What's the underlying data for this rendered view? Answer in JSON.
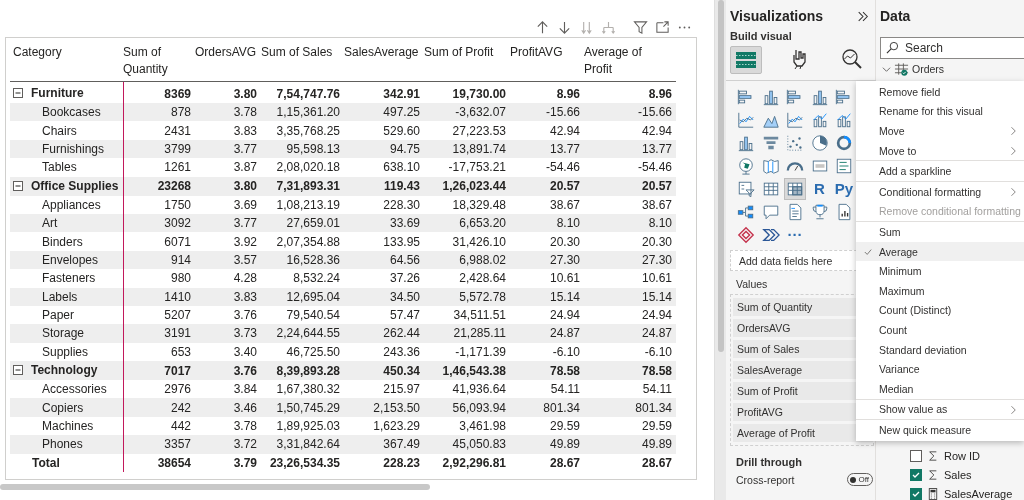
{
  "table": {
    "columns": [
      "Category",
      "Sum of Quantity",
      "OrdersAVG",
      "Sum of Sales",
      "SalesAverage",
      "Sum of Profit",
      "ProfitAVG",
      "Average of Profit"
    ],
    "groups": [
      {
        "name": "Furniture",
        "expanded": true,
        "values": [
          "8369",
          "3.80",
          "7,54,747.76",
          "342.91",
          "19,730.00",
          "8.96",
          "8.96"
        ],
        "children": [
          {
            "name": "Bookcases",
            "values": [
              "878",
              "3.78",
              "1,15,361.20",
              "497.25",
              "-3,632.07",
              "-15.66",
              "-15.66"
            ]
          },
          {
            "name": "Chairs",
            "values": [
              "2431",
              "3.83",
              "3,35,768.25",
              "529.60",
              "27,223.53",
              "42.94",
              "42.94"
            ]
          },
          {
            "name": "Furnishings",
            "values": [
              "3799",
              "3.77",
              "95,598.13",
              "94.75",
              "13,891.74",
              "13.77",
              "13.77"
            ]
          },
          {
            "name": "Tables",
            "values": [
              "1261",
              "3.87",
              "2,08,020.18",
              "638.10",
              "-17,753.21",
              "-54.46",
              "-54.46"
            ]
          }
        ]
      },
      {
        "name": "Office Supplies",
        "expanded": true,
        "values": [
          "23268",
          "3.80",
          "7,31,893.31",
          "119.43",
          "1,26,023.44",
          "20.57",
          "20.57"
        ],
        "children": [
          {
            "name": "Appliances",
            "values": [
              "1750",
              "3.69",
              "1,08,213.19",
              "228.30",
              "18,329.48",
              "38.67",
              "38.67"
            ]
          },
          {
            "name": "Art",
            "values": [
              "3092",
              "3.77",
              "27,659.01",
              "33.69",
              "6,653.20",
              "8.10",
              "8.10"
            ]
          },
          {
            "name": "Binders",
            "values": [
              "6071",
              "3.92",
              "2,07,354.88",
              "133.95",
              "31,426.10",
              "20.30",
              "20.30"
            ]
          },
          {
            "name": "Envelopes",
            "values": [
              "914",
              "3.57",
              "16,528.36",
              "64.56",
              "6,988.02",
              "27.30",
              "27.30"
            ]
          },
          {
            "name": "Fasteners",
            "values": [
              "980",
              "4.28",
              "8,532.24",
              "37.26",
              "2,428.64",
              "10.61",
              "10.61"
            ]
          },
          {
            "name": "Labels",
            "values": [
              "1410",
              "3.83",
              "12,695.04",
              "34.50",
              "5,572.78",
              "15.14",
              "15.14"
            ]
          },
          {
            "name": "Paper",
            "values": [
              "5207",
              "3.76",
              "79,540.54",
              "57.47",
              "34,511.51",
              "24.94",
              "24.94"
            ]
          },
          {
            "name": "Storage",
            "values": [
              "3191",
              "3.73",
              "2,24,644.55",
              "262.44",
              "21,285.11",
              "24.87",
              "24.87"
            ]
          },
          {
            "name": "Supplies",
            "values": [
              "653",
              "3.40",
              "46,725.50",
              "243.36",
              "-1,171.39",
              "-6.10",
              "-6.10"
            ]
          }
        ]
      },
      {
        "name": "Technology",
        "expanded": true,
        "values": [
          "7017",
          "3.76",
          "8,39,893.28",
          "450.34",
          "1,46,543.38",
          "78.58",
          "78.58"
        ],
        "children": [
          {
            "name": "Accessories",
            "values": [
              "2976",
              "3.84",
              "1,67,380.32",
              "215.97",
              "41,936.64",
              "54.11",
              "54.11"
            ]
          },
          {
            "name": "Copiers",
            "values": [
              "242",
              "3.46",
              "1,50,745.29",
              "2,153.50",
              "56,093.94",
              "801.34",
              "801.34"
            ]
          },
          {
            "name": "Machines",
            "values": [
              "442",
              "3.78",
              "1,89,925.03",
              "1,623.29",
              "3,461.98",
              "29.59",
              "29.59"
            ]
          },
          {
            "name": "Phones",
            "values": [
              "3357",
              "3.72",
              "3,31,842.64",
              "367.49",
              "45,050.83",
              "49.89",
              "49.89"
            ]
          }
        ]
      }
    ],
    "total": {
      "label": "Total",
      "values": [
        "38654",
        "3.79",
        "23,26,534.35",
        "228.23",
        "2,92,296.81",
        "28.67",
        "28.67"
      ]
    }
  },
  "visualizations_pane": {
    "title": "Visualizations",
    "subtitle": "Build visual",
    "build_tabs": [
      {
        "kind": "build",
        "selected": true
      },
      {
        "kind": "format",
        "selected": false
      },
      {
        "kind": "analytics",
        "selected": false
      }
    ],
    "visual_types": [
      {
        "kind": "bar",
        "selected": false
      },
      {
        "kind": "column",
        "selected": false
      },
      {
        "kind": "bar",
        "selected": false
      },
      {
        "kind": "column",
        "selected": false
      },
      {
        "kind": "bar",
        "selected": false
      },
      {
        "kind": "line",
        "selected": false
      },
      {
        "kind": "area",
        "selected": false
      },
      {
        "kind": "line",
        "selected": false
      },
      {
        "kind": "combo",
        "selected": false
      },
      {
        "kind": "combo",
        "selected": false
      },
      {
        "kind": "column",
        "selected": false
      },
      {
        "kind": "funnel",
        "selected": false
      },
      {
        "kind": "scatter",
        "selected": false
      },
      {
        "kind": "pie",
        "selected": false
      },
      {
        "kind": "donut",
        "selected": false
      },
      {
        "kind": "globe",
        "selected": false
      },
      {
        "kind": "map",
        "selected": false
      },
      {
        "kind": "gauge",
        "selected": false
      },
      {
        "kind": "card",
        "selected": false
      },
      {
        "kind": "multirow",
        "selected": false
      },
      {
        "kind": "slicer",
        "selected": false
      },
      {
        "kind": "table",
        "selected": false
      },
      {
        "kind": "matrix",
        "selected": true
      },
      {
        "kind": "letter",
        "label": "R",
        "selected": false
      },
      {
        "kind": "letter",
        "label": "Py",
        "selected": false
      },
      {
        "kind": "tree",
        "selected": false
      },
      {
        "kind": "bubble",
        "selected": false
      },
      {
        "kind": "doc",
        "selected": false
      },
      {
        "kind": "trophy",
        "selected": false
      },
      {
        "kind": "report",
        "selected": false
      },
      {
        "kind": "diamond",
        "selected": false
      },
      {
        "kind": "chevrons",
        "selected": false
      },
      {
        "kind": "letter",
        "label": "···",
        "selected": false
      }
    ],
    "drop_placeholder": "Add data fields here",
    "values_label": "Values",
    "value_fields": [
      "Sum of Quantity",
      "OrdersAVG",
      "Sum of Sales",
      "SalesAverage",
      "Sum of Profit",
      "ProfitAVG",
      "Average of Profit"
    ],
    "drill_through": "Drill through",
    "cross_report": {
      "label": "Cross-report",
      "on": false,
      "state_label": "Off"
    }
  },
  "data_pane": {
    "title": "Data",
    "search": {
      "placeholder": "Search"
    },
    "tables": [
      {
        "name": "Orders",
        "expanded": true,
        "fields": [
          {
            "name": "Row ID",
            "kind": "sum",
            "checked": false
          },
          {
            "name": "Sales",
            "kind": "sum",
            "checked": true
          },
          {
            "name": "SalesAverage",
            "kind": "measure",
            "checked": true
          }
        ]
      }
    ]
  },
  "context_menu": {
    "sections": [
      [
        {
          "label": "Remove field",
          "kind": "action",
          "disabled": false,
          "checked": false
        },
        {
          "label": "Rename for this visual",
          "kind": "action",
          "disabled": false,
          "checked": false
        },
        {
          "label": "Move",
          "kind": "submenu",
          "disabled": false,
          "checked": false
        },
        {
          "label": "Move to",
          "kind": "submenu",
          "disabled": false,
          "checked": false
        }
      ],
      [
        {
          "label": "Add a sparkline",
          "kind": "action",
          "disabled": false,
          "checked": false
        }
      ],
      [
        {
          "label": "Conditional formatting",
          "kind": "submenu",
          "disabled": false,
          "checked": false
        },
        {
          "label": "Remove conditional formatting",
          "kind": "action",
          "disabled": true,
          "checked": false
        }
      ],
      [
        {
          "label": "Sum",
          "kind": "action",
          "disabled": false,
          "checked": false
        },
        {
          "label": "Average",
          "kind": "action",
          "disabled": false,
          "checked": true
        },
        {
          "label": "Minimum",
          "kind": "action",
          "disabled": false,
          "checked": false
        },
        {
          "label": "Maximum",
          "kind": "action",
          "disabled": false,
          "checked": false
        },
        {
          "label": "Count (Distinct)",
          "kind": "action",
          "disabled": false,
          "checked": false
        },
        {
          "label": "Count",
          "kind": "action",
          "disabled": false,
          "checked": false
        },
        {
          "label": "Standard deviation",
          "kind": "action",
          "disabled": false,
          "checked": false
        },
        {
          "label": "Variance",
          "kind": "action",
          "disabled": false,
          "checked": false
        },
        {
          "label": "Median",
          "kind": "action",
          "disabled": false,
          "checked": false
        }
      ],
      [
        {
          "label": "Show value as",
          "kind": "submenu",
          "disabled": false,
          "checked": false
        }
      ],
      [
        {
          "label": "New quick measure",
          "kind": "action",
          "disabled": false,
          "checked": false
        }
      ]
    ]
  }
}
